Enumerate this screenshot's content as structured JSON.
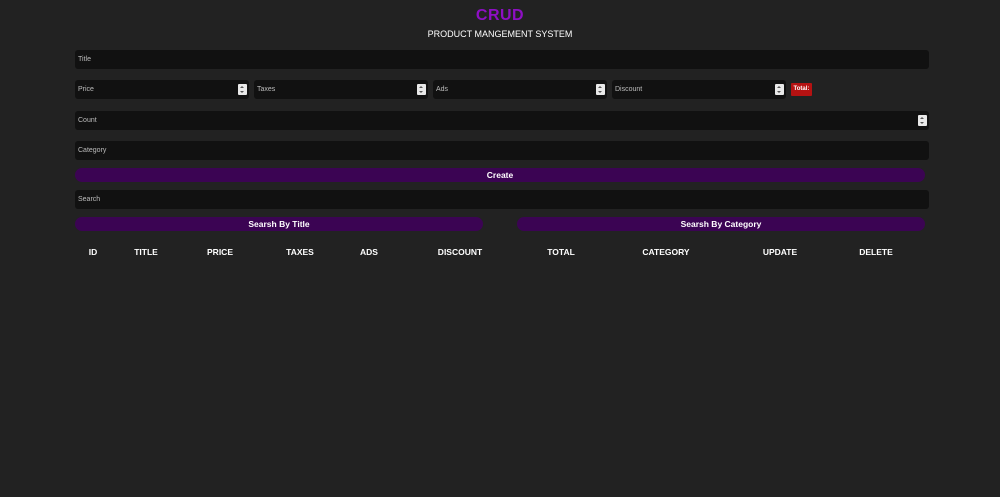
{
  "header": {
    "title": "CRUD",
    "subtitle": "PRODUCT MANGEMENT SYSTEM"
  },
  "form": {
    "title_placeholder": "Title",
    "price_placeholder": "Price",
    "taxes_placeholder": "Taxes",
    "ads_placeholder": "Ads",
    "discount_placeholder": "Discount",
    "total_label": "Total:",
    "count_placeholder": "Count",
    "category_placeholder": "Category",
    "create_label": "Create"
  },
  "search": {
    "placeholder": "Search",
    "by_title_label": "Searsh By Title",
    "by_category_label": "Searsh By Category"
  },
  "table": {
    "headers": [
      "ID",
      "TITLE",
      "PRICE",
      "TAXES",
      "ADS",
      "DISCOUNT",
      "TOTAL",
      "CATEGORY",
      "UPDATE",
      "DELETE"
    ]
  },
  "colors": {
    "background": "#222222",
    "input": "#111111",
    "accent": "#8e0fc4",
    "button": "#3b0453",
    "total_badge": "#b51212"
  }
}
